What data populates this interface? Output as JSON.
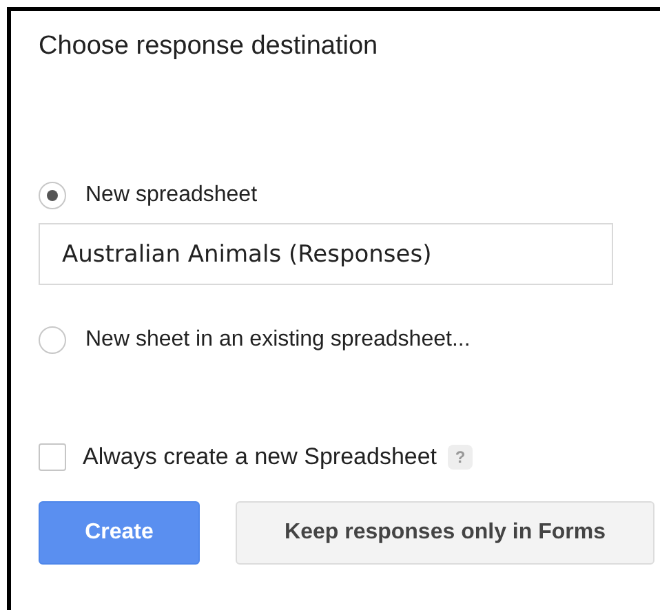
{
  "dialog": {
    "title": "Choose response destination"
  },
  "options": [
    {
      "kind": "radio",
      "label": "New spreadsheet",
      "selected": true,
      "field": {
        "value": "Australian Animals (Responses)"
      }
    },
    {
      "kind": "radio",
      "label": "New sheet in an existing spreadsheet...",
      "selected": false
    }
  ],
  "always_create": {
    "label": "Always create a new Spreadsheet",
    "checked": false,
    "help": "?"
  },
  "buttons": [
    {
      "label": "Create",
      "kind": "primary"
    },
    {
      "label": "Keep responses only in Forms",
      "kind": "secondary"
    }
  ]
}
